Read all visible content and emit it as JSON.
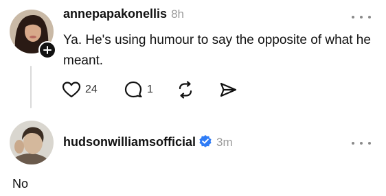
{
  "posts": [
    {
      "username": "annepapakonellis",
      "time": "8h",
      "text": "Ya. He's using humour to say the opposite of what he meant.",
      "likes": "24",
      "comments": "1"
    },
    {
      "username": "hudsonwilliamsofficial",
      "time": "3m",
      "text": "No",
      "verified": true
    }
  ],
  "colors": {
    "text": "#111111",
    "muted": "#9a9a9a",
    "verified": "#2f7cf6",
    "thread_line": "#d9d9d9"
  },
  "icons": [
    "plus-icon",
    "heart-icon",
    "comment-icon",
    "repost-icon",
    "share-icon",
    "more-icon",
    "verified-icon"
  ]
}
